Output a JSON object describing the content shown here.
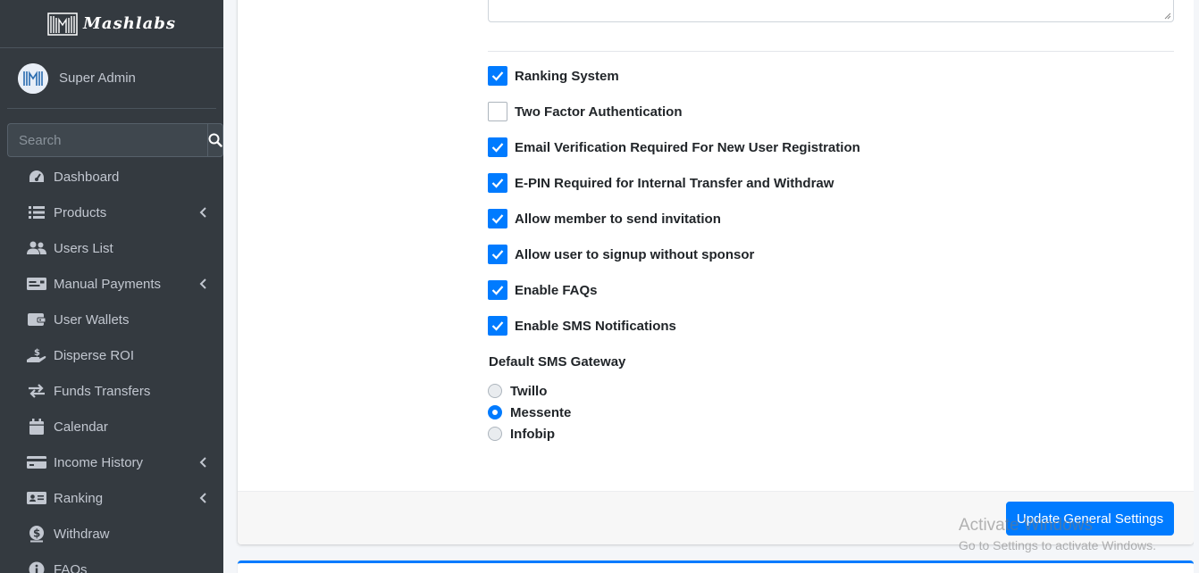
{
  "brand": {
    "name": "Mashlabs"
  },
  "user": {
    "name": "Super Admin"
  },
  "search": {
    "placeholder": "Search"
  },
  "sidebar": {
    "items": [
      {
        "label": "Dashboard",
        "icon": "tachometer-icon",
        "has_children": false
      },
      {
        "label": "Products",
        "icon": "list-icon",
        "has_children": true
      },
      {
        "label": "Users List",
        "icon": "users-icon",
        "has_children": false
      },
      {
        "label": "Manual Payments",
        "icon": "money-check-icon",
        "has_children": true
      },
      {
        "label": "User Wallets",
        "icon": "wallet-icon",
        "has_children": false
      },
      {
        "label": "Disperse ROI",
        "icon": "hand-holding-dollar-icon",
        "has_children": false
      },
      {
        "label": "Funds Transfers",
        "icon": "exchange-icon",
        "has_children": false
      },
      {
        "label": "Calendar",
        "icon": "calendar-icon",
        "has_children": false
      },
      {
        "label": "Income History",
        "icon": "credit-card-icon",
        "has_children": true
      },
      {
        "label": "Ranking",
        "icon": "id-card-icon",
        "has_children": true
      },
      {
        "label": "Withdraw",
        "icon": "dollar-circle-icon",
        "has_children": false
      },
      {
        "label": "FAQs",
        "icon": "info-circle-icon",
        "has_children": false
      }
    ]
  },
  "settings": {
    "checkboxes": [
      {
        "label": "Ranking System",
        "checked": true
      },
      {
        "label": "Two Factor Authentication",
        "checked": false
      },
      {
        "label": "Email Verification Required For New User Registration",
        "checked": true
      },
      {
        "label": "E-PIN Required for Internal Transfer and Withdraw",
        "checked": true
      },
      {
        "label": "Allow member to send invitation",
        "checked": true
      },
      {
        "label": "Allow user to signup without sponsor",
        "checked": true
      },
      {
        "label": "Enable FAQs",
        "checked": true
      },
      {
        "label": "Enable SMS Notifications",
        "checked": true
      }
    ],
    "sms_gateway": {
      "label": "Default SMS Gateway",
      "options": [
        {
          "label": "Twillo",
          "selected": false
        },
        {
          "label": "Messente",
          "selected": true
        },
        {
          "label": "Infobip",
          "selected": false
        }
      ]
    },
    "submit_label": "Update General Settings"
  },
  "watermark": {
    "title": "Activate Windows",
    "subtitle": "Go to Settings to activate Windows."
  },
  "colors": {
    "sidebar_bg": "#343a40",
    "primary": "#007bff",
    "sidebar_text": "#c2c7d0"
  }
}
